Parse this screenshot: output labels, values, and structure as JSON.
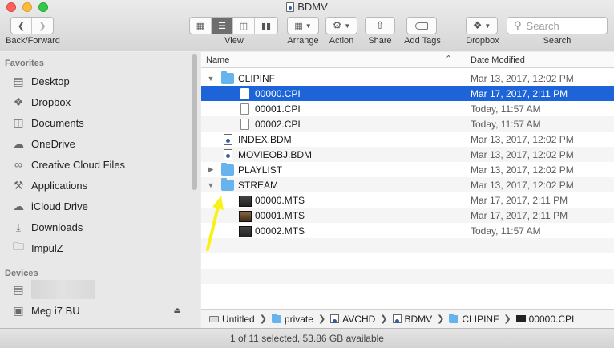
{
  "window": {
    "title": "BDMV"
  },
  "toolbar": {
    "back_forward_label": "Back/Forward",
    "view_label": "View",
    "arrange_label": "Arrange",
    "action_label": "Action",
    "share_label": "Share",
    "add_tags_label": "Add Tags",
    "dropbox_label": "Dropbox",
    "search_label": "Search",
    "search_placeholder": "Search"
  },
  "sidebar": {
    "favorites_header": "Favorites",
    "favorites": [
      {
        "label": "Desktop",
        "icon": "desktop-icon"
      },
      {
        "label": "Dropbox",
        "icon": "dropbox-icon"
      },
      {
        "label": "Documents",
        "icon": "documents-icon"
      },
      {
        "label": "OneDrive",
        "icon": "cloud-icon"
      },
      {
        "label": "Creative Cloud Files",
        "icon": "creative-cloud-icon"
      },
      {
        "label": "Applications",
        "icon": "applications-icon"
      },
      {
        "label": "iCloud Drive",
        "icon": "icloud-icon"
      },
      {
        "label": "Downloads",
        "icon": "downloads-icon"
      },
      {
        "label": "ImpulZ",
        "icon": "folder-icon"
      }
    ],
    "devices_header": "Devices",
    "devices": [
      {
        "label": "",
        "icon": "computer-icon"
      },
      {
        "label": "Meg i7 BU",
        "icon": "drive-icon"
      }
    ]
  },
  "columns": {
    "name": "Name",
    "date_modified": "Date Modified"
  },
  "files": [
    {
      "name": "CLIPINF",
      "date": "Mar 13, 2017, 12:02 PM",
      "kind": "folder",
      "expanded": true,
      "depth": 0
    },
    {
      "name": "00000.CPI",
      "date": "Mar 17, 2017, 2:11 PM",
      "kind": "file",
      "depth": 1,
      "selected": true
    },
    {
      "name": "00001.CPI",
      "date": "Today, 11:57 AM",
      "kind": "file",
      "depth": 1
    },
    {
      "name": "00002.CPI",
      "date": "Today, 11:57 AM",
      "kind": "file",
      "depth": 1
    },
    {
      "name": "INDEX.BDM",
      "date": "Mar 13, 2017, 12:02 PM",
      "kind": "bdm",
      "depth": 0
    },
    {
      "name": "MOVIEOBJ.BDM",
      "date": "Mar 13, 2017, 12:02 PM",
      "kind": "bdm",
      "depth": 0
    },
    {
      "name": "PLAYLIST",
      "date": "Mar 13, 2017, 12:02 PM",
      "kind": "folder",
      "expanded": false,
      "depth": 0
    },
    {
      "name": "STREAM",
      "date": "Mar 13, 2017, 12:02 PM",
      "kind": "folder",
      "expanded": true,
      "depth": 0
    },
    {
      "name": "00000.MTS",
      "date": "Mar 17, 2017, 2:11 PM",
      "kind": "mts",
      "depth": 1
    },
    {
      "name": "00001.MTS",
      "date": "Mar 17, 2017, 2:11 PM",
      "kind": "mts2",
      "depth": 1
    },
    {
      "name": "00002.MTS",
      "date": "Today, 11:57 AM",
      "kind": "mts",
      "depth": 1
    }
  ],
  "pathbar": [
    "Untitled",
    "private",
    "AVCHD",
    "BDMV",
    "CLIPINF",
    "00000.CPI"
  ],
  "status": "1 of 11 selected, 53.86 GB available",
  "colors": {
    "selection": "#1d64d8",
    "folder": "#67b3ee",
    "arrow": "#f7f21a"
  }
}
